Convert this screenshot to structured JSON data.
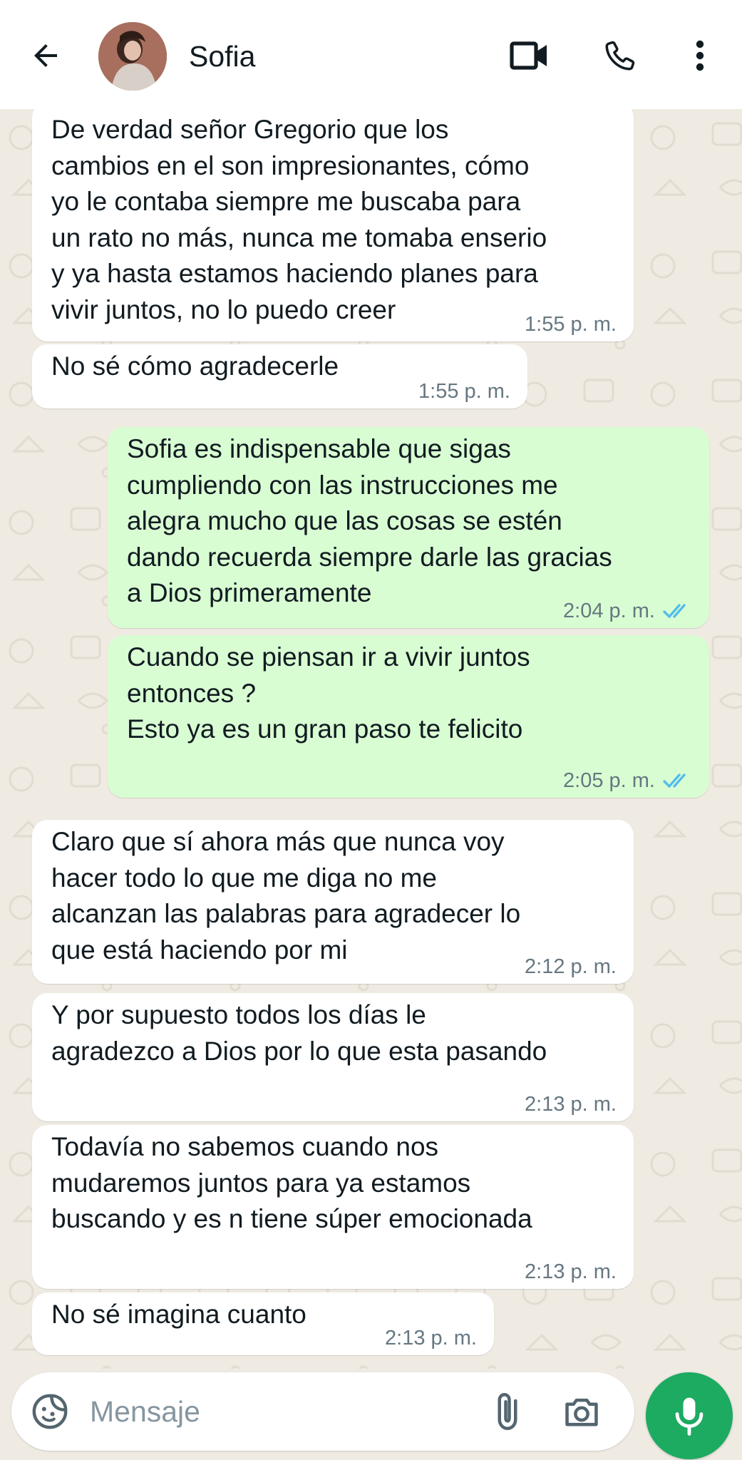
{
  "header": {
    "contact_name": "Sofia",
    "icons": {
      "back": "arrow-left-icon",
      "video": "video-camera-icon",
      "call": "phone-icon",
      "menu": "more-vertical-icon"
    }
  },
  "messages": [
    {
      "direction": "in",
      "text": "De verdad señor Gregorio que los\ncambios en el son impresionantes, cómo\nyo le contaba siempre me buscaba para\nun rato no más, nunca me tomaba enserio\ny ya hasta estamos haciendo planes para\nvivir juntos, no lo puedo creer",
      "time": "1:55 p. m."
    },
    {
      "direction": "in",
      "text": "No sé cómo agradecerle",
      "time": "1:55 p. m."
    },
    {
      "direction": "out",
      "text": "Sofia es indispensable que sigas\ncumpliendo con las instrucciones me\nalegra mucho que las cosas se estén\ndando recuerda siempre darle las gracias\na Dios primeramente",
      "time": "2:04 p. m.",
      "status": "read"
    },
    {
      "direction": "out",
      "text": "Cuando se piensan ir a vivir juntos\nentonces ?\nEsto ya es un gran paso te felicito",
      "time": "2:05 p. m.",
      "status": "read"
    },
    {
      "direction": "in",
      "text": "Claro que sí ahora más que nunca voy\nhacer todo lo que me diga no me\nalcanzan las palabras para agradecer lo\nque está haciendo por mi",
      "time": "2:12 p. m."
    },
    {
      "direction": "in",
      "text": "Y por supuesto todos los días le\nagradezco a Dios por lo que esta pasando",
      "time": "2:13 p. m."
    },
    {
      "direction": "in",
      "text": "Todavía no sabemos cuando nos\nmudaremos juntos para ya estamos\nbuscando y es n tiene súper emocionada",
      "time": "2:13 p. m."
    },
    {
      "direction": "in",
      "text": "No sé imagina cuanto",
      "time": "2:13 p. m."
    }
  ],
  "composer": {
    "placeholder": "Mensaje",
    "icons": {
      "emoji": "sticker-icon",
      "attach": "paperclip-icon",
      "camera": "camera-icon",
      "mic": "microphone-icon"
    }
  },
  "colors": {
    "chat_background": "#efeae2",
    "incoming_bubble": "#ffffff",
    "outgoing_bubble": "#d9fdd3",
    "read_check": "#53bdeb",
    "mic_button": "#1daa61"
  }
}
